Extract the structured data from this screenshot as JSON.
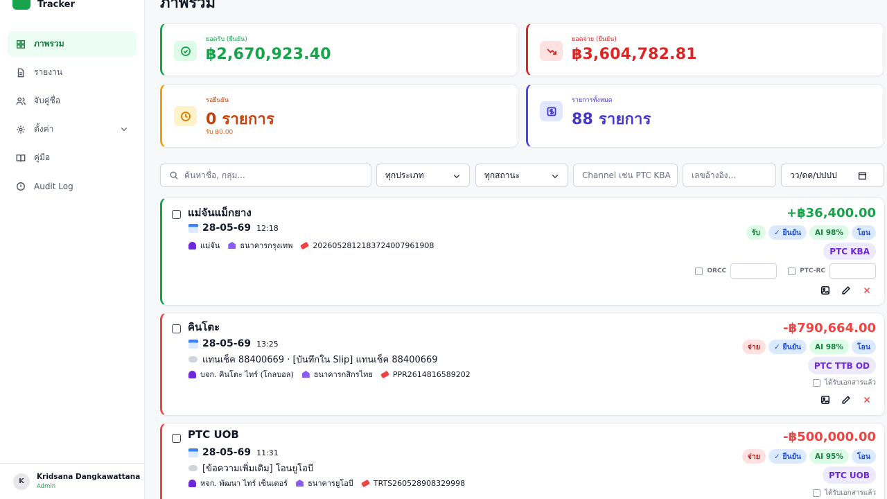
{
  "app": {
    "brand_line": "Tracker",
    "page_title": "ภาพรวม"
  },
  "sidebar": {
    "items": [
      {
        "label": "ภาพรวม",
        "icon": "dashboard-icon",
        "active": true
      },
      {
        "label": "รายงาน",
        "icon": "document-icon"
      },
      {
        "label": "จับคู่ชื่อ",
        "icon": "users-icon"
      },
      {
        "label": "ตั้งค่า",
        "icon": "gear-icon",
        "has_caret": true
      },
      {
        "label": "คู่มือ",
        "icon": "book-icon"
      },
      {
        "label": "Audit Log",
        "icon": "shield-icon"
      }
    ],
    "user": {
      "initial": "K",
      "name": "Kridsana Dangkawattana",
      "role": "Admin"
    }
  },
  "stats": {
    "income": {
      "label": "ยอดรับ (ยืนยัน)",
      "value": "฿2,670,923.40",
      "color": "#16a34a"
    },
    "expense": {
      "label": "ยอดจ่าย (ยืนยัน)",
      "value": "฿3,604,782.81",
      "color": "#dc2626"
    },
    "pending": {
      "label": "รอยืนยัน",
      "value": "0 รายการ",
      "sub": "รับ ฿0.00",
      "color": "#c2410c"
    },
    "total": {
      "label": "รายการทั้งหมด",
      "value": "88 รายการ",
      "color": "#4338ca"
    }
  },
  "filters": {
    "search_placeholder": "ค้นหาชื่อ, กลุ่ม...",
    "type_value": "ทุกประเภท",
    "status_value": "ทุกสถานะ",
    "channel_placeholder": "Channel เช่น PTC KBA",
    "ref_placeholder": "เลขอ้างอิง...",
    "date_value": "วว/ดด/ปปปป"
  },
  "transactions": [
    {
      "name": "แม่จันแม็กยาง",
      "date": "28-05-69",
      "time": "12:18",
      "person": "แม่จัน",
      "bank": "ธนาคารกรุงเทพ",
      "ref": "202605281218372400796190​8",
      "amount": "+฿36,400.00",
      "direction": "รับ",
      "status": "✓ ยืนยัน",
      "ai": "AI 98%",
      "method": "โอน",
      "channel": "PTC KBA",
      "orcc_label": "ORCC",
      "ptcrc_label": "PTC-RC"
    },
    {
      "name": "คินโตะ",
      "date": "28-05-69",
      "time": "13:25",
      "note": "แทนเช็ค 88400669 · [บันทึกใน Slip] แทนเช็ค 88400669",
      "person": "บจก. คินโตะ ไทร์ (โกลบอล)",
      "bank": "ธนาคารกสิกรไทย",
      "ref": "PPR2614816589202",
      "amount": "-฿790,664.00",
      "direction": "จ่าย",
      "status": "✓ ยืนยัน",
      "ai": "AI 98%",
      "method": "โอน",
      "channel": "PTC TTB OD",
      "doc_label": "ได้รับเอกสารแล้ว"
    },
    {
      "name": "PTC UOB",
      "date": "28-05-69",
      "time": "11:31",
      "note": "[ข้อความเพิ่มเติม] โอนยูโอบี",
      "person": "หจก. พัฒนา ไทร์ เซ็นเตอร์",
      "bank": "ธนาคารยูโอบี",
      "ref": "TRTS260528908329998",
      "amount": "-฿500,000.00",
      "direction": "จ่าย",
      "status": "✓ ยืนยัน",
      "ai": "AI 95%",
      "method": "โอน",
      "channel": "PTC UOB",
      "doc_label": "ได้รับเอกสารแล้ว"
    }
  ],
  "colors": {
    "positive": "#16a34a",
    "negative": "#ef4444",
    "accent_purple": "#6d28d9"
  }
}
